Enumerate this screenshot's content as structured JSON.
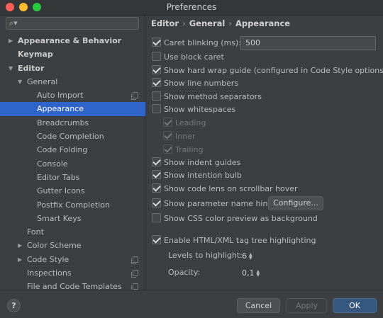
{
  "window": {
    "title": "Preferences"
  },
  "sidebar": {
    "search_placeholder": "",
    "items": [
      {
        "label": "Appearance & Behavior",
        "arrow": "▶"
      },
      {
        "label": "Keymap"
      },
      {
        "label": "Editor",
        "arrow": "▼"
      },
      {
        "label": "General",
        "arrow": "▼"
      },
      {
        "label": "Auto Import"
      },
      {
        "label": "Appearance"
      },
      {
        "label": "Breadcrumbs"
      },
      {
        "label": "Code Completion"
      },
      {
        "label": "Code Folding"
      },
      {
        "label": "Console"
      },
      {
        "label": "Editor Tabs"
      },
      {
        "label": "Gutter Icons"
      },
      {
        "label": "Postfix Completion"
      },
      {
        "label": "Smart Keys"
      },
      {
        "label": "Font"
      },
      {
        "label": "Color Scheme",
        "arrow": "▶"
      },
      {
        "label": "Code Style",
        "arrow": "▶"
      },
      {
        "label": "Inspections"
      },
      {
        "label": "File and Code Templates"
      }
    ]
  },
  "main": {
    "breadcrumb": [
      "Editor",
      "General",
      "Appearance"
    ],
    "breadcrumb_sep": "›",
    "caret_blinking": {
      "label": "Caret blinking (ms):",
      "value": "500"
    },
    "use_block_caret": "Use block caret",
    "show_hard_wrap": "Show hard wrap guide (configured in Code Style options)",
    "show_line_numbers": "Show line numbers",
    "show_method_separators": "Show method separators",
    "show_whitespaces": "Show whitespaces",
    "leading": "Leading",
    "inner": "Inner",
    "trailing": "Trailing",
    "show_indent_guides": "Show indent guides",
    "show_intention_bulb": "Show intention bulb",
    "show_code_lens": "Show code lens on scrollbar hover",
    "show_param_hints": "Show parameter name hints",
    "configure_button": "Configure...",
    "show_css_preview": "Show CSS color preview as background",
    "enable_html_tag_tree": "Enable HTML/XML tag tree highlighting",
    "levels_label": "Levels to highlight:",
    "levels_value": "6",
    "opacity_label": "Opacity:",
    "opacity_value": "0,1"
  },
  "footer": {
    "help": "?",
    "cancel": "Cancel",
    "apply": "Apply",
    "ok": "OK"
  },
  "colors": {
    "accent": "#2f65ca",
    "ok_button": "#365880",
    "background": "#3c3f41"
  }
}
